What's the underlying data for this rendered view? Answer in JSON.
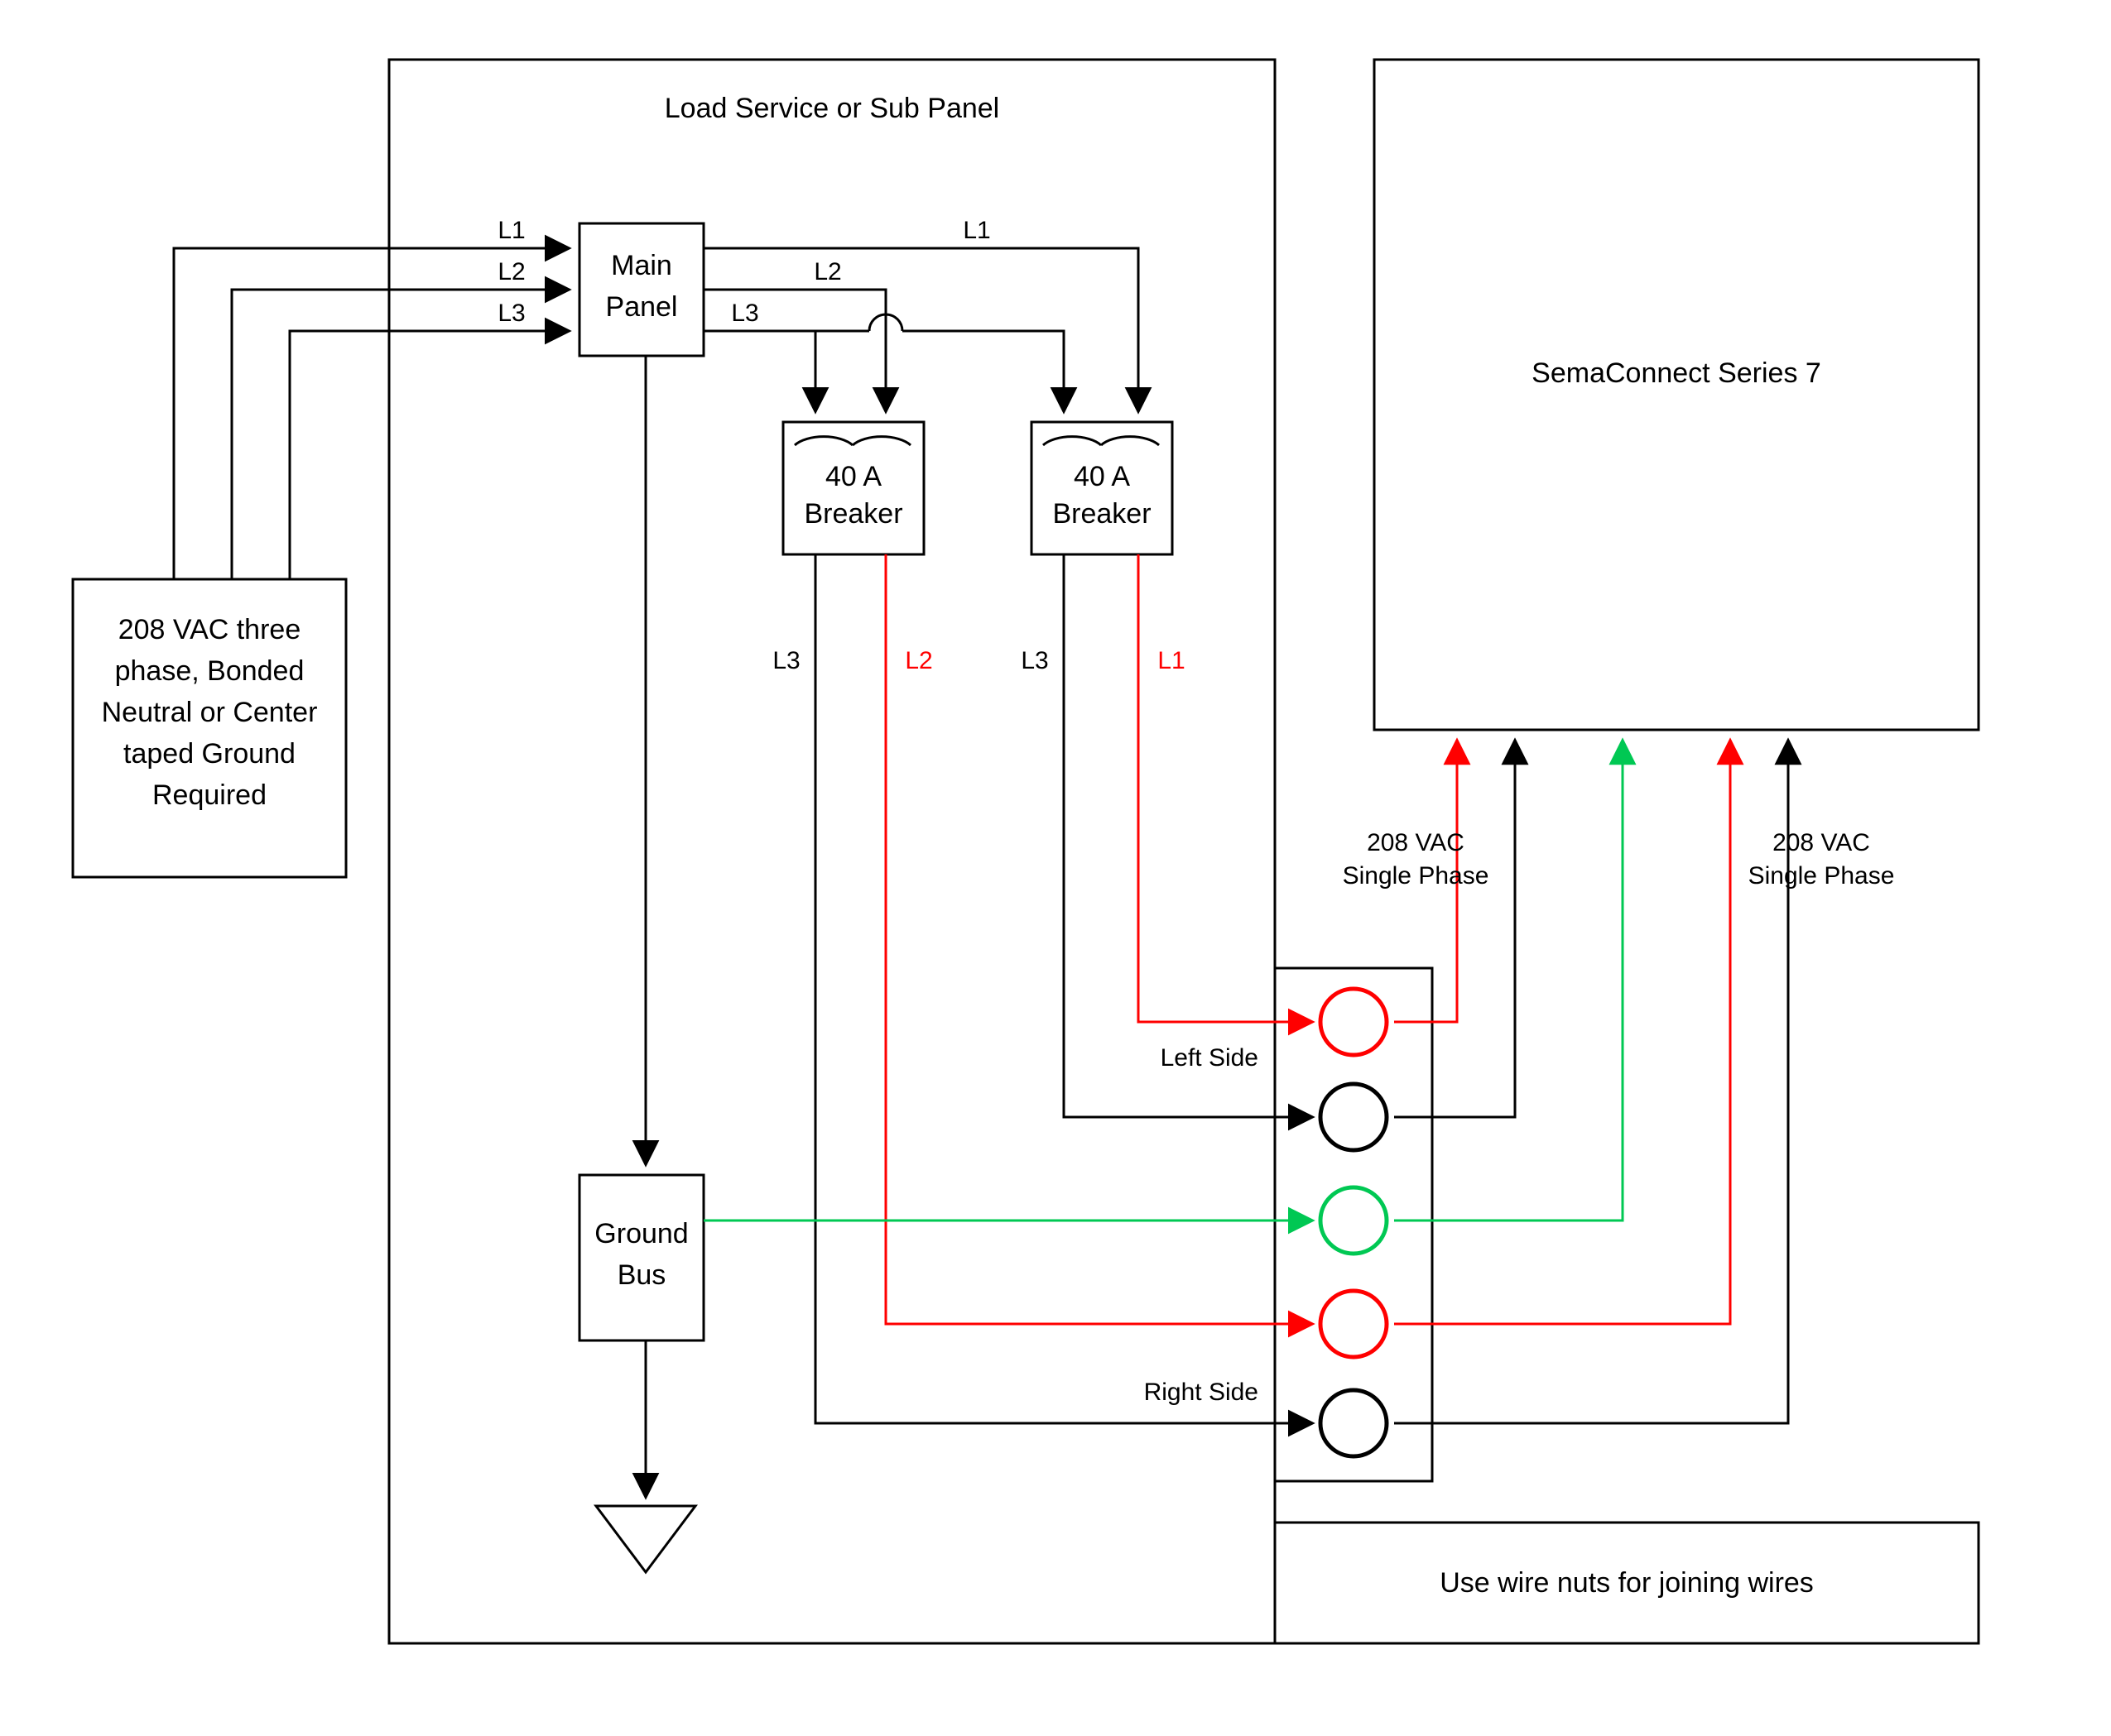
{
  "diagram": {
    "panel": {
      "title": "Load Service or Sub Panel"
    },
    "source": {
      "l1": "208 VAC three",
      "l2": "phase, Bonded",
      "l3": "Neutral or Center",
      "l4": "taped Ground",
      "l5": "Required"
    },
    "main_panel": {
      "line1": "Main",
      "line2": "Panel"
    },
    "breaker_left": {
      "line1": "40 A",
      "line2": "Breaker"
    },
    "breaker_right": {
      "line1": "40 A",
      "line2": "Breaker"
    },
    "ground_bus": {
      "line1": "Ground",
      "line2": "Bus"
    },
    "semaconnect": {
      "title": "SemaConnect Series 7"
    },
    "left_side_label": "Left Side",
    "right_side_label": "Right Side",
    "wire_nuts_label": "Use wire nuts for joining wires",
    "voltage_left": {
      "line1": "208 VAC",
      "line2": "Single Phase"
    },
    "voltage_right": {
      "line1": "208 VAC",
      "line2": "Single Phase"
    },
    "lines": {
      "L1_in": "L1",
      "L2_in": "L2",
      "L3_in": "L3",
      "L1_out": "L1",
      "L2_out": "L2",
      "L3_out": "L3",
      "brk1_L3": "L3",
      "brk1_L2": "L2",
      "brk2_L3": "L3",
      "brk2_L1": "L1"
    },
    "colors": {
      "black": "#000000",
      "red": "#ff0000",
      "green": "#00c853"
    }
  }
}
